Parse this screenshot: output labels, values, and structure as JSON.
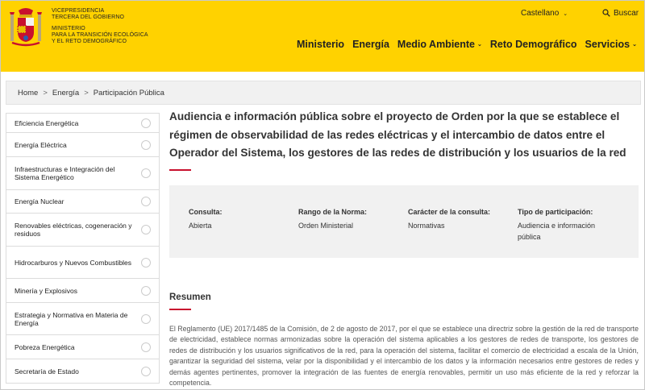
{
  "header": {
    "gov_line1": "VICEPRESIDENCIA",
    "gov_line2": "TERCERA DEL GOBIERNO",
    "ministry_line1": "MINISTERIO",
    "ministry_line2": "PARA LA TRANSICIÓN ECOLÓGICA",
    "ministry_line3": "Y EL RETO DEMOGRÁFICO",
    "language": "Castellano",
    "search_label": "Buscar",
    "nav": [
      "Ministerio",
      "Energía",
      "Medio Ambiente",
      "Reto Demográfico",
      "Servicios"
    ]
  },
  "breadcrumb": [
    "Home",
    "Energía",
    "Participación Pública"
  ],
  "sidebar": {
    "items": [
      "Eficiencia Energética",
      "Energía Eléctrica",
      "Infraestructuras e Integración del Sistema Energético",
      "Energía Nuclear",
      "Renovables eléctricas, cogeneración y residuos",
      "Hidrocarburos y Nuevos Combustibles",
      "Minería y Explosivos",
      "Estrategia y Normativa en Materia de Energía",
      "Pobreza Energética",
      "Secretaría de Estado"
    ]
  },
  "main": {
    "title": "Audiencia e información pública sobre el proyecto de Orden por la que se establece el régimen de observabilidad de las redes eléctricas y el intercambio de datos entre el Operador del Sistema, los gestores de las redes de distribución y los usuarios de la red",
    "info": [
      {
        "label": "Consulta:",
        "value": "Abierta"
      },
      {
        "label": "Rango de la Norma:",
        "value": "Orden Ministerial"
      },
      {
        "label": "Carácter de la consulta:",
        "value": "Normativas"
      },
      {
        "label": "Tipo de participación:",
        "value": "Audiencia e información pública"
      }
    ],
    "resumen_heading": "Resumen",
    "resumen_text": "El Reglamento (UE) 2017/1485 de la Comisión, de 2 de agosto de 2017, por el que se establece una directriz sobre la gestión de la red de transporte de electricidad, establece normas armonizadas sobre la operación del sistema aplicables a los gestores de redes de transporte, los gestores de redes de distribución y los usuarios significativos de la red, para la operación del sistema, facilitar el comercio de electricidad a escala de la Unión, garantizar la seguridad del sistema, velar por la disponibilidad y el intercambio de los datos y la información necesarios entre gestores de redes y demás agentes pertinentes, promover la integración de las fuentes de energía renovables, permitir un uso más eficiente de la red y reforzar la competencia."
  },
  "colors": {
    "header_bg": "#ffd200",
    "accent": "#c8102e",
    "panel_bg": "#f1f1f1"
  }
}
